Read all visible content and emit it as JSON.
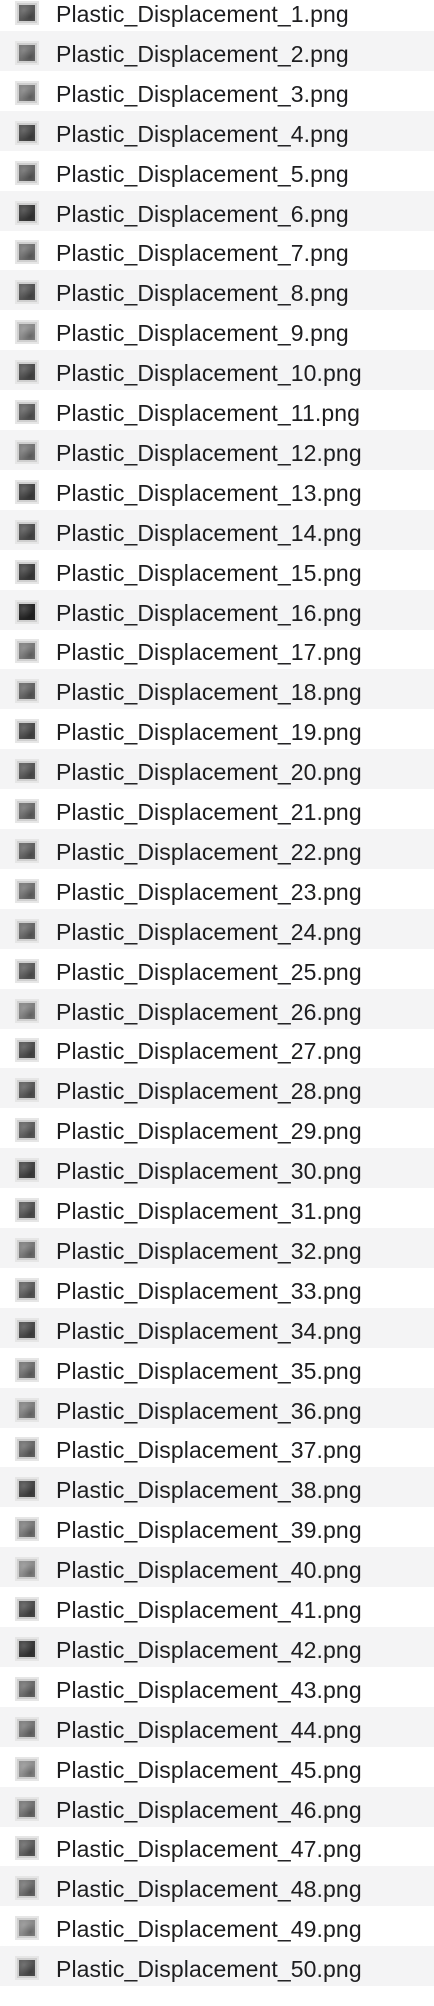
{
  "files": [
    {
      "name": "Plastic_Displacement_1.png",
      "thumbnail_color": "#5a5a5a"
    },
    {
      "name": "Plastic_Displacement_2.png",
      "thumbnail_color": "#6e6e6e"
    },
    {
      "name": "Plastic_Displacement_3.png",
      "thumbnail_color": "#7c7c7c"
    },
    {
      "name": "Plastic_Displacement_4.png",
      "thumbnail_color": "#4a4a4a"
    },
    {
      "name": "Plastic_Displacement_5.png",
      "thumbnail_color": "#666666"
    },
    {
      "name": "Plastic_Displacement_6.png",
      "thumbnail_color": "#3c3c3c"
    },
    {
      "name": "Plastic_Displacement_7.png",
      "thumbnail_color": "#707070"
    },
    {
      "name": "Plastic_Displacement_8.png",
      "thumbnail_color": "#555555"
    },
    {
      "name": "Plastic_Displacement_9.png",
      "thumbnail_color": "#8a8a8a"
    },
    {
      "name": "Plastic_Displacement_10.png",
      "thumbnail_color": "#4e4e4e"
    },
    {
      "name": "Plastic_Displacement_11.png",
      "thumbnail_color": "#5e5e5e"
    },
    {
      "name": "Plastic_Displacement_12.png",
      "thumbnail_color": "#747474"
    },
    {
      "name": "Plastic_Displacement_13.png",
      "thumbnail_color": "#454545"
    },
    {
      "name": "Plastic_Displacement_14.png",
      "thumbnail_color": "#505050"
    },
    {
      "name": "Plastic_Displacement_15.png",
      "thumbnail_color": "#404040"
    },
    {
      "name": "Plastic_Displacement_16.png",
      "thumbnail_color": "#262626"
    },
    {
      "name": "Plastic_Displacement_17.png",
      "thumbnail_color": "#7a7a7a"
    },
    {
      "name": "Plastic_Displacement_18.png",
      "thumbnail_color": "#646464"
    },
    {
      "name": "Plastic_Displacement_19.png",
      "thumbnail_color": "#4c4c4c"
    },
    {
      "name": "Plastic_Displacement_20.png",
      "thumbnail_color": "#585858"
    },
    {
      "name": "Plastic_Displacement_21.png",
      "thumbnail_color": "#6c6c6c"
    },
    {
      "name": "Plastic_Displacement_22.png",
      "thumbnail_color": "#626262"
    },
    {
      "name": "Plastic_Displacement_23.png",
      "thumbnail_color": "#727272"
    },
    {
      "name": "Plastic_Displacement_24.png",
      "thumbnail_color": "#686868"
    },
    {
      "name": "Plastic_Displacement_25.png",
      "thumbnail_color": "#5c5c5c"
    },
    {
      "name": "Plastic_Displacement_26.png",
      "thumbnail_color": "#808080"
    },
    {
      "name": "Plastic_Displacement_27.png",
      "thumbnail_color": "#505050"
    },
    {
      "name": "Plastic_Displacement_28.png",
      "thumbnail_color": "#5a5a5a"
    },
    {
      "name": "Plastic_Displacement_29.png",
      "thumbnail_color": "#606060"
    },
    {
      "name": "Plastic_Displacement_30.png",
      "thumbnail_color": "#444444"
    },
    {
      "name": "Plastic_Displacement_31.png",
      "thumbnail_color": "#565656"
    },
    {
      "name": "Plastic_Displacement_32.png",
      "thumbnail_color": "#787878"
    },
    {
      "name": "Plastic_Displacement_33.png",
      "thumbnail_color": "#5e5e5e"
    },
    {
      "name": "Plastic_Displacement_34.png",
      "thumbnail_color": "#4a4a4a"
    },
    {
      "name": "Plastic_Displacement_35.png",
      "thumbnail_color": "#707070"
    },
    {
      "name": "Plastic_Displacement_36.png",
      "thumbnail_color": "#7e7e7e"
    },
    {
      "name": "Plastic_Displacement_37.png",
      "thumbnail_color": "#6a6a6a"
    },
    {
      "name": "Plastic_Displacement_38.png",
      "thumbnail_color": "#484848"
    },
    {
      "name": "Plastic_Displacement_39.png",
      "thumbnail_color": "#7a7a7a"
    },
    {
      "name": "Plastic_Displacement_40.png",
      "thumbnail_color": "#8c8c8c"
    },
    {
      "name": "Plastic_Displacement_41.png",
      "thumbnail_color": "#4e4e4e"
    },
    {
      "name": "Plastic_Displacement_42.png",
      "thumbnail_color": "#3a3a3a"
    },
    {
      "name": "Plastic_Displacement_43.png",
      "thumbnail_color": "#6c6c6c"
    },
    {
      "name": "Plastic_Displacement_44.png",
      "thumbnail_color": "#767676"
    },
    {
      "name": "Plastic_Displacement_45.png",
      "thumbnail_color": "#8e8e8e"
    },
    {
      "name": "Plastic_Displacement_46.png",
      "thumbnail_color": "#727272"
    },
    {
      "name": "Plastic_Displacement_47.png",
      "thumbnail_color": "#606060"
    },
    {
      "name": "Plastic_Displacement_48.png",
      "thumbnail_color": "#6e6e6e"
    },
    {
      "name": "Plastic_Displacement_49.png",
      "thumbnail_color": "#8a8a8a"
    },
    {
      "name": "Plastic_Displacement_50.png",
      "thumbnail_color": "#545454"
    }
  ]
}
